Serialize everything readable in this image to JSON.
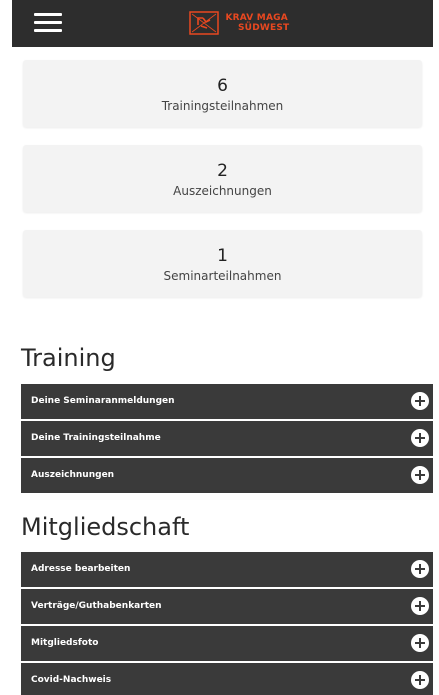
{
  "header": {
    "logo_line1": "KRAV MAGA",
    "logo_line2": "SÜDWEST",
    "menu_icon": "hamburger-menu-icon",
    "brand_color": "#e94820",
    "bar_color": "#2d2d2d"
  },
  "stats": [
    {
      "value": "6",
      "label": "Trainingsteilnahmen"
    },
    {
      "value": "2",
      "label": "Auszeichnungen"
    },
    {
      "value": "1",
      "label": "Seminarteilnahmen"
    }
  ],
  "training": {
    "title": "Training",
    "items": [
      {
        "label": "Deine Seminaranmeldungen",
        "icon": "plus-circle-icon"
      },
      {
        "label": "Deine Trainingsteilnahme",
        "icon": "plus-circle-icon"
      },
      {
        "label": "Auszeichnungen",
        "icon": "plus-circle-icon"
      }
    ]
  },
  "membership": {
    "title": "Mitgliedschaft",
    "items": [
      {
        "label": "Adresse bearbeiten",
        "icon": "plus-circle-icon"
      },
      {
        "label": "Verträge/Guthabenkarten",
        "icon": "plus-circle-icon"
      },
      {
        "label": "Mitgliedsfoto",
        "icon": "plus-circle-icon"
      },
      {
        "label": "Covid-Nachweis",
        "icon": "plus-circle-icon"
      }
    ]
  },
  "colors": {
    "accordion_bg": "#3a3a3a",
    "card_bg": "#f3f3f3"
  }
}
